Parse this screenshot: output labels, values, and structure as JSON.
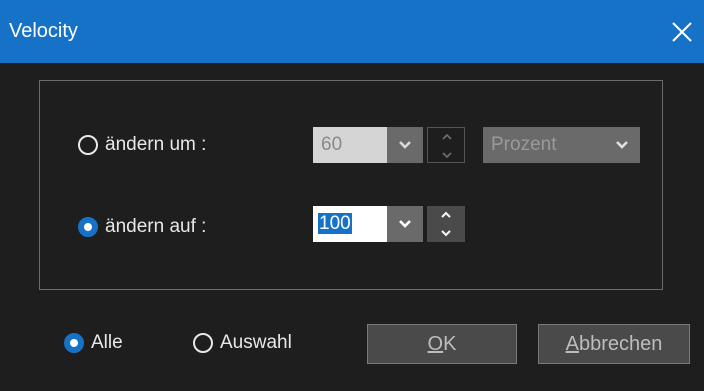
{
  "window": {
    "title": "Velocity",
    "title_bar_color": "#1672c6"
  },
  "icons": {
    "close": "close-icon",
    "combo_arrow": "chevron-down-icon",
    "spin_up": "chevron-up-icon",
    "spin_down": "chevron-down-icon"
  },
  "change_by": {
    "label": "ändern um :",
    "selected": false,
    "value": "60",
    "enabled": false,
    "unit": {
      "value": "Prozent",
      "enabled": false
    }
  },
  "change_to": {
    "label": "ändern auf :",
    "selected": true,
    "value": "100",
    "text_selected": true,
    "enabled": true
  },
  "scope": {
    "all_label": "Alle",
    "all_selected": true,
    "selection_label": "Auswahl",
    "selection_selected": false
  },
  "buttons": {
    "ok": {
      "mnemonic": "O",
      "rest": "K"
    },
    "cancel": {
      "mnemonic": "A",
      "rest": "bbrechen"
    }
  }
}
